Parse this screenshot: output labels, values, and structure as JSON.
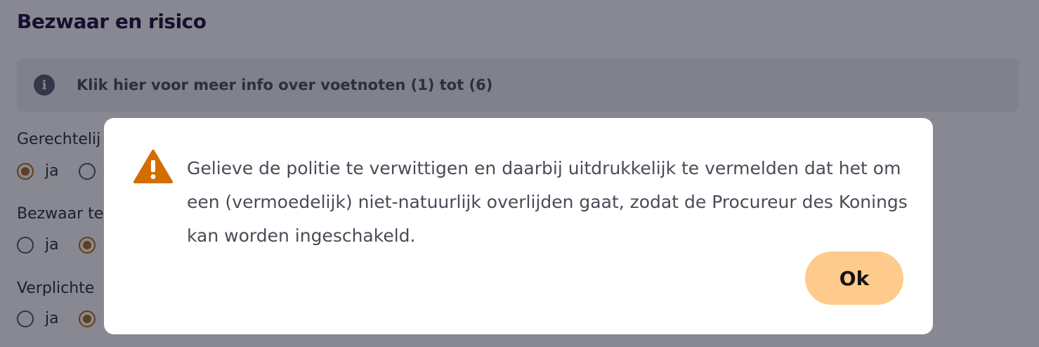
{
  "section": {
    "title": "Bezwaar en risico"
  },
  "info_banner": {
    "icon": "info-icon",
    "icon_glyph": "i",
    "text": "Klik hier voor meer info over voetnoten (1) tot (6)"
  },
  "questions": [
    {
      "label": "Gerechtelij",
      "option_yes": "ja",
      "selected": "ja"
    },
    {
      "label": "Bezwaar te",
      "option_yes": "ja",
      "selected": "other"
    },
    {
      "label": "Verplichte",
      "option_yes": "ja",
      "selected": "other"
    }
  ],
  "dialog": {
    "icon": "warning-icon",
    "message": "Gelieve de politie te verwittigen en daarbij uitdrukkelijk te vermelden dat het om een (vermoedelijk) niet-natuurlijk overlijden gaat, zodat de Procureur des Konings kan worden ingeschakeld.",
    "ok_label": "Ok"
  },
  "colors": {
    "title": "#1a0f3c",
    "radio_selected": "#b06a10",
    "warning": "#d26e00",
    "ok_button": "#ffcb8c",
    "overlay": "rgba(15, 18, 35, 0.5)"
  }
}
